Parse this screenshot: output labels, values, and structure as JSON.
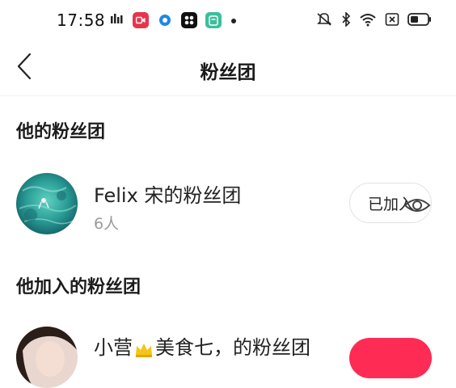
{
  "status_bar": {
    "time": "17:58"
  },
  "nav": {
    "title": "粉丝团"
  },
  "sections": {
    "his_fan_club": {
      "heading": "他的粉丝团",
      "item": {
        "name": "Felix 宋的粉丝团",
        "count": "6人",
        "button_label": "已加入"
      }
    },
    "joined_fan_clubs": {
      "heading": "他加入的粉丝团",
      "item": {
        "name_part1": "小营",
        "name_part2": "美食七",
        "name_suffix": "的粉丝团"
      }
    }
  },
  "colors": {
    "accent_pink": "#fe2c55"
  },
  "icons": {
    "back": "chevron-left-icon",
    "eye": "eye-icon",
    "crown": "crown-icon"
  }
}
